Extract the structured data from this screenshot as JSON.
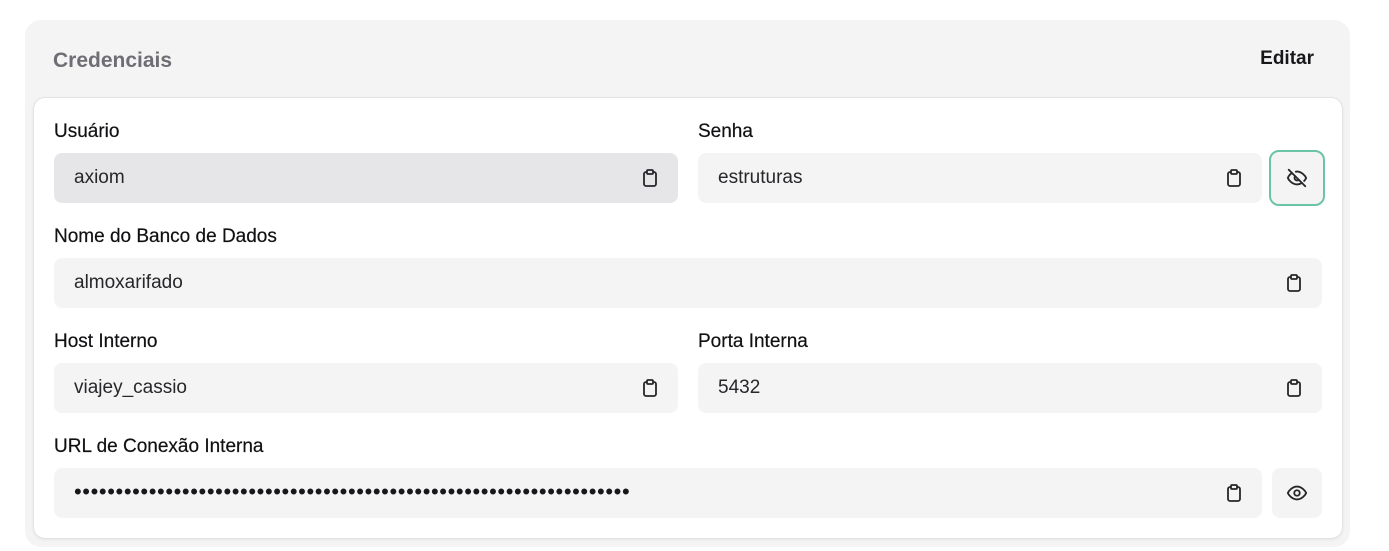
{
  "header": {
    "title": "Credenciais",
    "edit_label": "Editar"
  },
  "fields": {
    "usuario": {
      "label": "Usuário",
      "value": "axiom"
    },
    "senha": {
      "label": "Senha",
      "value": "estruturas"
    },
    "banco": {
      "label": "Nome do Banco de Dados",
      "value": "almoxarifado"
    },
    "host": {
      "label": "Host Interno",
      "value": "viajey_cassio"
    },
    "porta": {
      "label": "Porta Interna",
      "value": "5432"
    },
    "url": {
      "label": "URL de Conexão Interna",
      "value": "•••••••••••••••••••••••••••••••••••••••••••••••••••••••••••••••••••"
    }
  },
  "icons": {
    "copy": "clipboard-icon",
    "hide": "eye-off-icon",
    "show": "eye-icon"
  },
  "colors": {
    "focus_ring": "#6cc4a6",
    "card_bg": "#f4f4f4",
    "field_bg": "#f4f4f5",
    "disabled_field_bg": "#e6e6e8"
  }
}
